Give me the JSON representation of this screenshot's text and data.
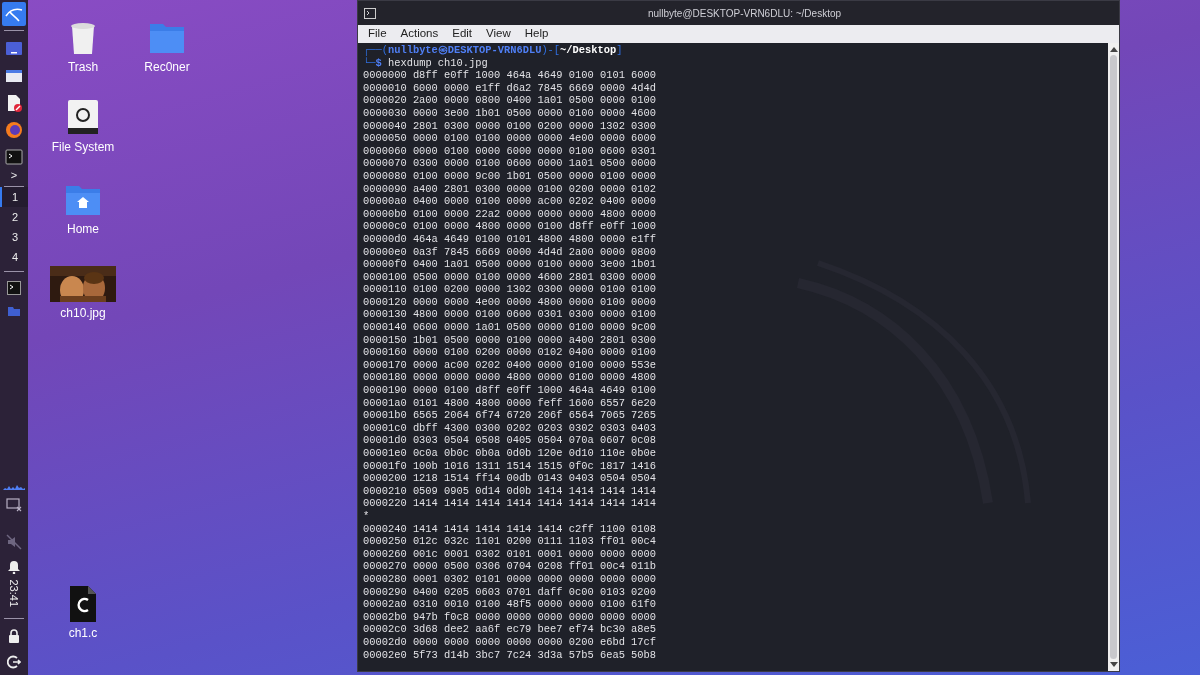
{
  "sidebar": {
    "launchers": [
      {
        "kind": "window"
      },
      {
        "kind": "folder"
      },
      {
        "kind": "document"
      },
      {
        "kind": "browser"
      },
      {
        "kind": "terminal"
      }
    ],
    "more": ">",
    "workspaces": [
      {
        "label": "1",
        "selected": true
      },
      {
        "label": "2",
        "selected": false
      },
      {
        "label": "3",
        "selected": false
      },
      {
        "label": "4",
        "selected": false
      }
    ],
    "tasks": [
      {
        "kind": "terminal"
      },
      {
        "kind": "folder"
      }
    ],
    "clock": "23:41"
  },
  "desktop_icons": [
    {
      "label": "Trash",
      "kind": "trash"
    },
    {
      "label": "Rec0ner",
      "kind": "folder"
    },
    {
      "label": "File System",
      "kind": "drive"
    },
    {
      "label": "Home",
      "kind": "home"
    },
    {
      "label": "ch10.jpg",
      "kind": "picture"
    },
    {
      "label": "ch1.c",
      "kind": "code"
    }
  ],
  "terminal": {
    "title": "nullbyte@DESKTOP-VRN6DLU: ~/Desktop",
    "menu": [
      "File",
      "Actions",
      "Edit",
      "View",
      "Help"
    ],
    "prompt": [
      {
        "text": "┌──(",
        "kind": "frame"
      },
      {
        "text": "nullbyte㉿DESKTOP-VRN6DLU",
        "kind": "user"
      },
      {
        "text": ")-[",
        "kind": "frame"
      },
      {
        "text": "~/Desktop",
        "kind": "path"
      },
      {
        "text": "]",
        "kind": "frame"
      }
    ],
    "prompt_symbol": [
      {
        "text": "└─",
        "kind": "frame"
      },
      {
        "text": "$",
        "kind": "user"
      }
    ],
    "command": "hexdump ch10.jpg",
    "output": [
      "0000000 d8ff e0ff 1000 464a 4649 0100 0101 6000",
      "0000010 6000 0000 e1ff d6a2 7845 6669 0000 4d4d",
      "0000020 2a00 0000 0800 0400 1a01 0500 0000 0100",
      "0000030 0000 3e00 1b01 0500 0000 0100 0000 4600",
      "0000040 2801 0300 0000 0100 0200 0000 1302 0300",
      "0000050 0000 0100 0100 0000 0000 4e00 0000 6000",
      "0000060 0000 0100 0000 6000 0000 0100 0600 0301",
      "0000070 0300 0000 0100 0600 0000 1a01 0500 0000",
      "0000080 0100 0000 9c00 1b01 0500 0000 0100 0000",
      "0000090 a400 2801 0300 0000 0100 0200 0000 0102",
      "00000a0 0400 0000 0100 0000 ac00 0202 0400 0000",
      "00000b0 0100 0000 22a2 0000 0000 0000 4800 0000",
      "00000c0 0100 0000 4800 0000 0100 d8ff e0ff 1000",
      "00000d0 464a 4649 0100 0101 4800 4800 0000 e1ff",
      "00000e0 0a3f 7845 6669 0000 4d4d 2a00 0000 0800",
      "00000f0 0400 1a01 0500 0000 0100 0000 3e00 1b01",
      "0000100 0500 0000 0100 0000 4600 2801 0300 0000",
      "0000110 0100 0200 0000 1302 0300 0000 0100 0100",
      "0000120 0000 0000 4e00 0000 4800 0000 0100 0000",
      "0000130 4800 0000 0100 0600 0301 0300 0000 0100",
      "0000140 0600 0000 1a01 0500 0000 0100 0000 9c00",
      "0000150 1b01 0500 0000 0100 0000 a400 2801 0300",
      "0000160 0000 0100 0200 0000 0102 0400 0000 0100",
      "0000170 0000 ac00 0202 0400 0000 0100 0000 553e",
      "0000180 0000 0000 0000 4800 0000 0100 0000 4800",
      "0000190 0000 0100 d8ff e0ff 1000 464a 4649 0100",
      "00001a0 0101 4800 4800 0000 feff 1600 6557 6e20",
      "00001b0 6565 2064 6f74 6720 206f 6564 7065 7265",
      "00001c0 dbff 4300 0300 0202 0203 0302 0303 0403",
      "00001d0 0303 0504 0508 0405 0504 070a 0607 0c08",
      "00001e0 0c0a 0b0c 0b0a 0d0b 120e 0d10 110e 0b0e",
      "00001f0 100b 1016 1311 1514 1515 0f0c 1817 1416",
      "0000200 1218 1514 ff14 00db 0143 0403 0504 0504",
      "0000210 0509 0905 0d14 0d0b 1414 1414 1414 1414",
      "0000220 1414 1414 1414 1414 1414 1414 1414 1414",
      "*",
      "0000240 1414 1414 1414 1414 1414 c2ff 1100 0108",
      "0000250 012c 032c 1101 0200 0111 1103 ff01 00c4",
      "0000260 001c 0001 0302 0101 0001 0000 0000 0000",
      "0000270 0000 0500 0306 0704 0208 ff01 00c4 011b",
      "0000280 0001 0302 0101 0000 0000 0000 0000 0000",
      "0000290 0400 0205 0603 0701 daff 0c00 0103 0200",
      "00002a0 0310 0010 0100 48f5 0000 0000 0100 61f0",
      "00002b0 947b f0c8 0000 0000 0000 0000 0000 0000",
      "00002c0 3d68 dee2 aa6f ec79 bee7 ef74 bc30 a8e5",
      "00002d0 0000 0000 0000 0000 0000 0200 e6bd 17cf",
      "00002e0 5f73 d14b 3bc7 7c24 3d3a 57b5 6ea5 50b8"
    ]
  }
}
